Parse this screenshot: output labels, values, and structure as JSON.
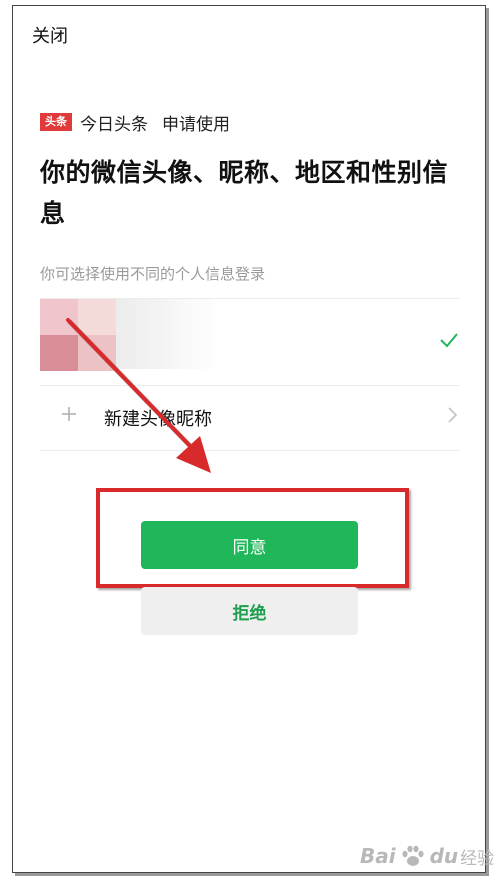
{
  "header": {
    "close_label": "关闭"
  },
  "app": {
    "logo_text": "头条",
    "name": "今日头条",
    "request_text": "申请使用",
    "logo_color": "#e03a3a"
  },
  "permission": {
    "title": "你的微信头像、昵称、地区和性别信息",
    "hint": "你可选择使用不同的个人信息登录"
  },
  "profiles": {
    "current_selected": true,
    "new_profile_label": "新建头像昵称"
  },
  "actions": {
    "agree_label": "同意",
    "reject_label": "拒绝",
    "agree_color": "#1fb75a",
    "reject_text_color": "#1f9e50"
  },
  "annotation": {
    "arrow_color": "#d82a2a",
    "box_color": "#d82a2a"
  },
  "watermark": {
    "text_latin_1": "Bai",
    "text_latin_2": "du",
    "text_cn": "经验"
  },
  "icons": {
    "check": "check-icon",
    "plus": "plus-icon",
    "chevron": "chevron-right-icon",
    "paw": "paw-icon"
  }
}
